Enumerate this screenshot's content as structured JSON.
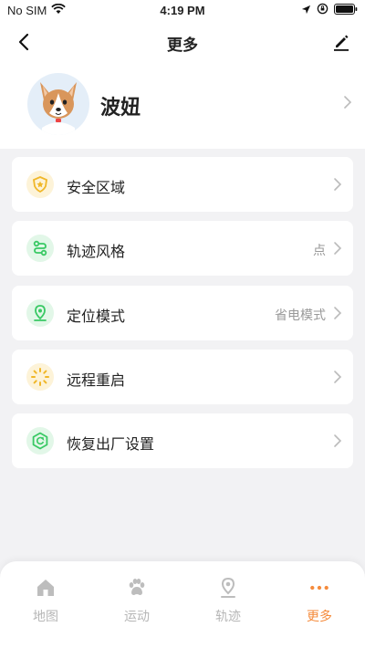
{
  "status_bar": {
    "carrier": "No SIM",
    "time": "4:19 PM"
  },
  "nav": {
    "title": "更多"
  },
  "profile": {
    "name": "波妞"
  },
  "menu": [
    {
      "label": "安全区域",
      "value": "",
      "icon": "shield-icon",
      "color": "#f0b728"
    },
    {
      "label": "轨迹风格",
      "value": "点",
      "icon": "route-icon",
      "color": "#39c964"
    },
    {
      "label": "定位模式",
      "value": "省电模式",
      "icon": "location-pin-icon",
      "color": "#39c964"
    },
    {
      "label": "远程重启",
      "value": "",
      "icon": "loading-icon",
      "color": "#f0b728"
    },
    {
      "label": "恢复出厂设置",
      "value": "",
      "icon": "reset-icon",
      "color": "#39c964"
    }
  ],
  "tabs": [
    {
      "label": "地图",
      "icon": "home-icon",
      "active": false
    },
    {
      "label": "运动",
      "icon": "paw-icon",
      "active": false
    },
    {
      "label": "轨迹",
      "icon": "track-icon",
      "active": false
    },
    {
      "label": "更多",
      "icon": "more-icon",
      "active": true
    }
  ],
  "colors": {
    "accent": "#f58b3c",
    "green": "#39c964",
    "yellow": "#f0b728",
    "background": "#f2f2f4"
  }
}
